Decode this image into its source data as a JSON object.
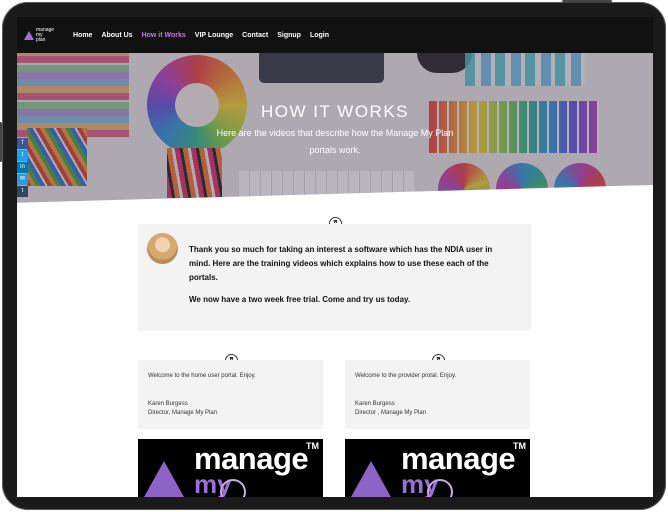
{
  "nav": {
    "logo": {
      "line1": "manage",
      "line2": "my",
      "line3": "plan"
    },
    "items": [
      {
        "label": "Home",
        "active": false
      },
      {
        "label": "About Us",
        "active": false
      },
      {
        "label": "How it Works",
        "active": true
      },
      {
        "label": "VIP Lounge",
        "active": false
      },
      {
        "label": "Contact",
        "active": false
      },
      {
        "label": "Signup",
        "active": false
      },
      {
        "label": "Login",
        "active": false
      }
    ]
  },
  "hero": {
    "title": "HOW IT WORKS",
    "subtitle": "Here are the videos that describe how the Manage My Plan portals work."
  },
  "social": [
    {
      "icon": "facebook-icon",
      "glyph": "f",
      "color": "#3b5998"
    },
    {
      "icon": "twitter-icon",
      "glyph": "t",
      "color": "#1da1f2"
    },
    {
      "icon": "linkedin-icon",
      "glyph": "in",
      "color": "#0077b5"
    },
    {
      "icon": "email-icon",
      "glyph": "✉",
      "color": "#2d9cdb"
    },
    {
      "icon": "tumblr-icon",
      "glyph": "t",
      "color": "#35465c"
    }
  ],
  "intro": {
    "quote_icon": "quote-icon",
    "paragraph1": "Thank you so much for taking an interest a software which has the NDIA user in mind. Here are the training videos which explains how to use these each of the portals.",
    "paragraph2": "We now have a two week free trial. Come and try us today."
  },
  "cards": [
    {
      "text": "Welcome to the home user portal. Enjoy.",
      "name": "Karen Burgess",
      "role": "Director, Manage My Plan"
    },
    {
      "text": "Welcome to the provider protal. Enjoy.",
      "name": "Karen Burgess",
      "role": "Director , Manage My Plan"
    }
  ],
  "video": {
    "word": "manage",
    "tm": "TM",
    "my": "my"
  },
  "colors": {
    "accent": "#c27be0",
    "nav_bg": "#111111",
    "box_bg": "#f3f3f3"
  }
}
